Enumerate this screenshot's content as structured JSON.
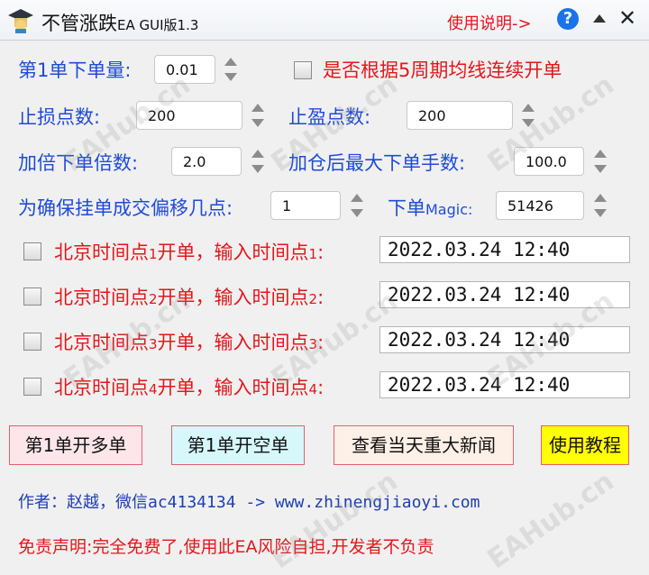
{
  "window": {
    "title": "不管涨跌",
    "title_suffix": "EA GUI版1.3",
    "help_link": "使用说明->",
    "help_icon": "?",
    "close_glyph": "✕"
  },
  "settings": {
    "first_lot_label": "第1单下单量:",
    "first_lot_value": "0.01",
    "ma_checkbox_label": "是否根据5周期均线连续开单",
    "stop_loss_label": "止损点数:",
    "stop_loss_value": "200",
    "take_profit_label": "止盈点数:",
    "take_profit_value": "200",
    "multiplier_label": "加倍下单倍数:",
    "multiplier_value": "2.0",
    "max_lot_label": "加仓后最大下单手数:",
    "max_lot_value": "100.0",
    "offset_label": "为确保挂单成交偏移几点:",
    "offset_value": "1",
    "magic_label_prefix": "下单",
    "magic_label_suffix": "Magic:",
    "magic_value": "51426"
  },
  "schedules": [
    {
      "label_a": "北京时间点",
      "index": "1",
      "label_b": "开单，输入时间点",
      "index2": "1",
      "colon": ":",
      "time": "2022.03.24 12:40"
    },
    {
      "label_a": "北京时间点",
      "index": "2",
      "label_b": "开单，输入时间点",
      "index2": "2",
      "colon": ":",
      "time": "2022.03.24 12:40"
    },
    {
      "label_a": "北京时间点",
      "index": "3",
      "label_b": "开单，输入时间点",
      "index2": "3",
      "colon": ":",
      "time": "2022.03.24 12:40"
    },
    {
      "label_a": "北京时间点",
      "index": "4",
      "label_b": "开单，输入时间点",
      "index2": "4",
      "colon": ":",
      "time": "2022.03.24 12:40"
    }
  ],
  "buttons": {
    "open_long": "第1单开多单",
    "open_short": "第1单开空单",
    "news": "查看当天重大新闻",
    "tutorial": "使用教程"
  },
  "footer": {
    "author": "作者：赵越，微信ac4134134 -> www.zhinengjiaoyi.com",
    "disclaimer": "免责声明:完全免费了,使用此EA风险自担,开发者不负责"
  },
  "watermark": "EAHub.cn",
  "colors": {
    "label_blue": "#1f4bd8",
    "label_red": "#e3171b",
    "long_button_bg": "#fde6ea",
    "short_button_bg": "#d6f8fb",
    "news_button_bg": "#fdf0e6",
    "tutorial_button_bg": "#ffff00"
  }
}
